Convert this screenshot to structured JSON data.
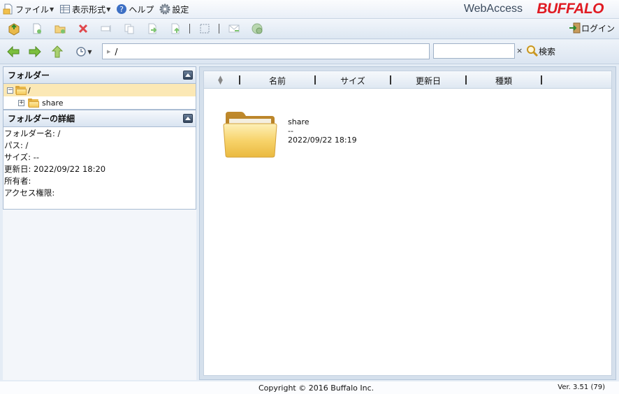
{
  "menu": {
    "file": "ファイル",
    "view": "表示形式",
    "help": "ヘルプ",
    "settings": "設定"
  },
  "brand": {
    "app_name": "WebAccess",
    "logo": "BUFFALO"
  },
  "toolbar": {
    "login": "ログイン"
  },
  "navbar": {
    "path_value": "/",
    "search_value": "",
    "clear": "×",
    "search_label": "検索"
  },
  "folder_panel": {
    "title": "フォルダー",
    "tree": [
      {
        "label": "/",
        "expander": "−"
      },
      {
        "label": "share",
        "expander": "+"
      }
    ]
  },
  "details_panel": {
    "title": "フォルダーの詳細",
    "rows": [
      "フォルダー名: /",
      "パス: /",
      "サイズ: --",
      "更新日: 2022/09/22 18:20",
      "所有者:",
      "アクセス権限:"
    ]
  },
  "columns": [
    "名前",
    "サイズ",
    "更新日",
    "種類"
  ],
  "files": [
    {
      "name": "share",
      "size": "--",
      "modified": "2022/09/22 18:19"
    }
  ],
  "footer": {
    "copyright": "Copyright © 2016 Buffalo Inc.",
    "version": "Ver. 3.51 (79)"
  },
  "colors": {
    "accent_red": "#e01a22",
    "selection": "#fbe8b5",
    "folder": "#f4c95a"
  }
}
